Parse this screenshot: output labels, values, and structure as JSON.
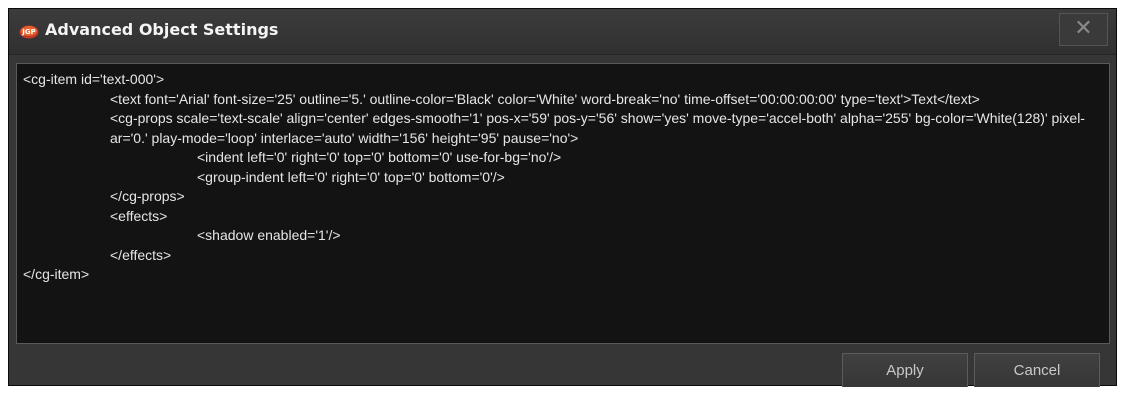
{
  "window": {
    "title": "Advanced Object Settings",
    "close_glyph": "✕",
    "logo_icon": "jgp-logo-icon"
  },
  "editor": {
    "lines": [
      "<cg-item id='text-000'>",
      "<text font='Arial' font-size='25' outline='5.' outline-color='Black' color='White' word-break='no' time-offset='00:00:00:00' type='text'>Text</text>",
      "<cg-props scale='text-scale' align='center' edges-smooth='1' pos-x='59' pos-y='56' show='yes' move-type='accel-both' alpha='255' bg-color='White(128)' pixel-ar='0.' play-mode='loop' interlace='auto' width='156' height='95' pause='no'>",
      "<indent left='0' right='0' top='0' bottom='0' use-for-bg='no'/>",
      "<group-indent left='0' right='0' top='0' bottom='0'/>",
      "</cg-props>",
      "<effects>",
      "<shadow enabled='1'/>",
      "</effects>",
      "</cg-item>"
    ]
  },
  "buttons": {
    "apply": "Apply",
    "cancel": "Cancel"
  }
}
